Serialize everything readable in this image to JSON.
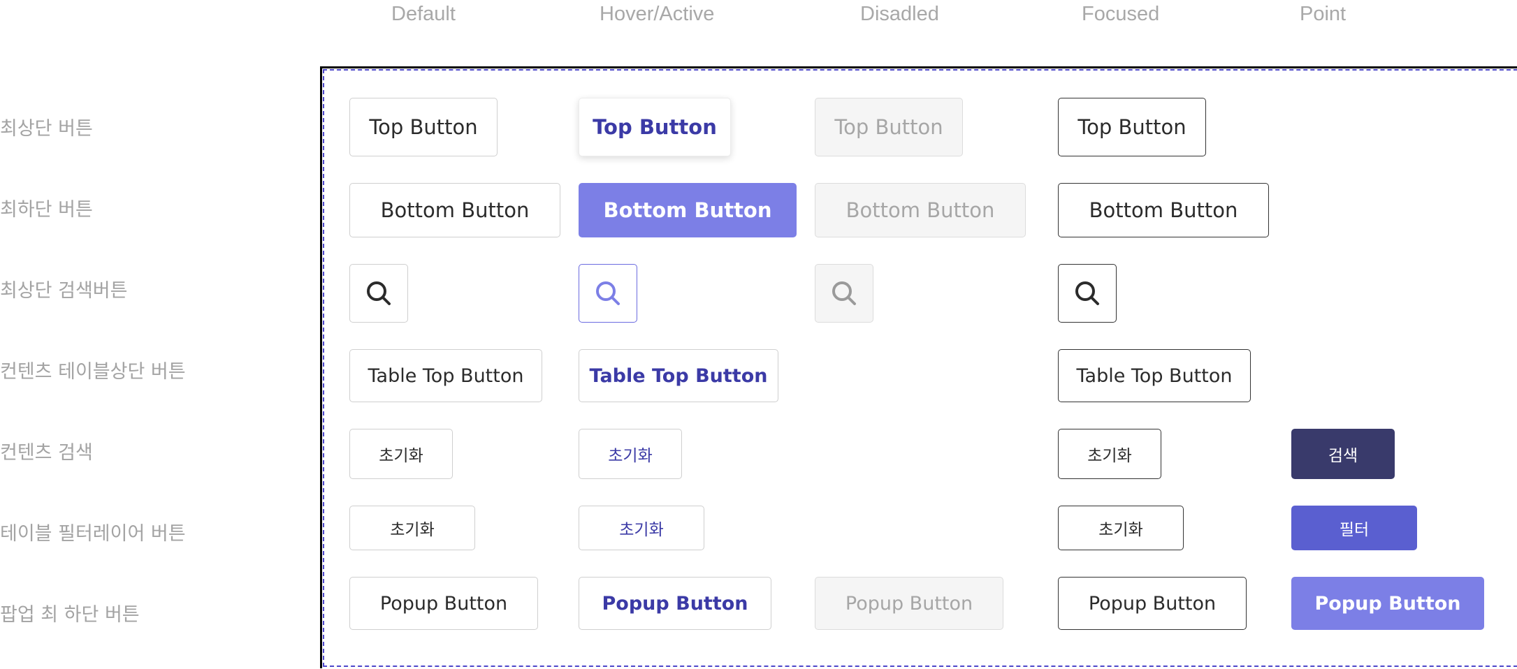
{
  "columns": [
    "Default",
    "Hover/Active",
    "Disadled",
    "Focused",
    "Point"
  ],
  "rows": [
    "최상단 버튼",
    "최하단 버튼",
    "최상단 검색버튼",
    "컨텐츠 테이블상단 버튼",
    "컨텐츠 검색",
    "테이블 필터레이어 버튼",
    "팝업 최 하단 버튼"
  ],
  "buttons": {
    "top": "Top Button",
    "bottom": "Bottom Button",
    "table_top": "Table Top Button",
    "reset": "초기화",
    "search": "검색",
    "filter": "필터",
    "popup": "Popup Button"
  },
  "icons": {
    "search": "search-icon"
  },
  "colors": {
    "accent": "#7c7fe6",
    "accent_text": "#3b3aa6",
    "point_navy": "#393a6b",
    "point_indigo": "#5a5fd0",
    "frame_dash": "#4c46c9"
  }
}
